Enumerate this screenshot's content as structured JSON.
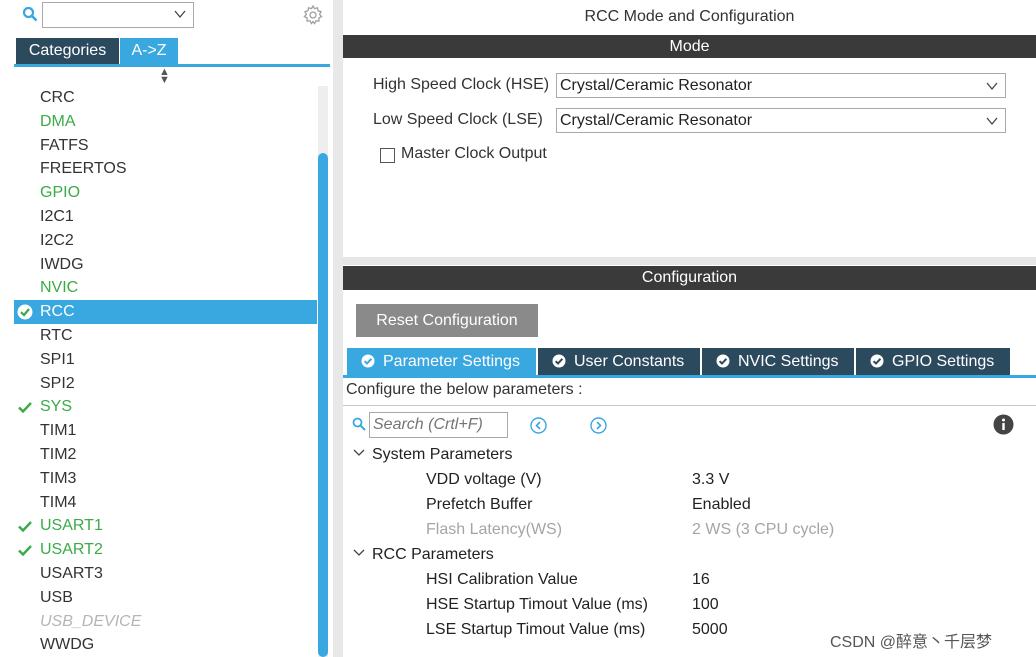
{
  "left": {
    "search_value": "",
    "tabs": {
      "categories": "Categories",
      "az": "A->Z"
    },
    "items": [
      {
        "label": "CRC",
        "state": "normal"
      },
      {
        "label": "DMA",
        "state": "green"
      },
      {
        "label": "FATFS",
        "state": "normal"
      },
      {
        "label": "FREERTOS",
        "state": "normal"
      },
      {
        "label": "GPIO",
        "state": "green"
      },
      {
        "label": "I2C1",
        "state": "normal"
      },
      {
        "label": "I2C2",
        "state": "normal"
      },
      {
        "label": "IWDG",
        "state": "normal"
      },
      {
        "label": "NVIC",
        "state": "green"
      },
      {
        "label": "RCC",
        "state": "selected"
      },
      {
        "label": "RTC",
        "state": "normal"
      },
      {
        "label": "SPI1",
        "state": "normal"
      },
      {
        "label": "SPI2",
        "state": "normal"
      },
      {
        "label": "SYS",
        "state": "checked"
      },
      {
        "label": "TIM1",
        "state": "normal"
      },
      {
        "label": "TIM2",
        "state": "normal"
      },
      {
        "label": "TIM3",
        "state": "normal"
      },
      {
        "label": "TIM4",
        "state": "normal"
      },
      {
        "label": "USART1",
        "state": "checked"
      },
      {
        "label": "USART2",
        "state": "checked"
      },
      {
        "label": "USART3",
        "state": "normal"
      },
      {
        "label": "USB",
        "state": "normal"
      },
      {
        "label": "USB_DEVICE",
        "state": "disabled"
      },
      {
        "label": "WWDG",
        "state": "normal"
      }
    ]
  },
  "right": {
    "title": "RCC Mode and Configuration",
    "mode_header": "Mode",
    "hse_label": "High Speed Clock (HSE)",
    "hse_value": "Crystal/Ceramic Resonator",
    "lse_label": "Low Speed Clock (LSE)",
    "lse_value": "Crystal/Ceramic Resonator",
    "mco_label": "Master Clock Output",
    "config_header": "Configuration",
    "reset_label": "Reset Configuration",
    "tabs": [
      "Parameter Settings",
      "User Constants",
      "NVIC Settings",
      "GPIO Settings"
    ],
    "configure_text": "Configure the below parameters :",
    "search_placeholder": "Search (Crtl+F)",
    "groups": [
      {
        "name": "System Parameters",
        "params": [
          {
            "name": "VDD voltage (V)",
            "value": "3.3 V"
          },
          {
            "name": "Prefetch Buffer",
            "value": "Enabled"
          },
          {
            "name": "Flash Latency(WS)",
            "value": "2 WS (3 CPU cycle)"
          }
        ]
      },
      {
        "name": "RCC Parameters",
        "params": [
          {
            "name": "HSI Calibration Value",
            "value": "16"
          },
          {
            "name": "HSE Startup Timout Value (ms)",
            "value": "100"
          },
          {
            "name": "LSE Startup Timout Value (ms)",
            "value": "5000"
          }
        ]
      }
    ]
  },
  "watermark": "CSDN @醉意丶千层梦",
  "colors": {
    "accent": "#39a7e0",
    "dark_tab": "#2c4a5e",
    "green": "#3aab47",
    "header": "#3a3a3a"
  }
}
